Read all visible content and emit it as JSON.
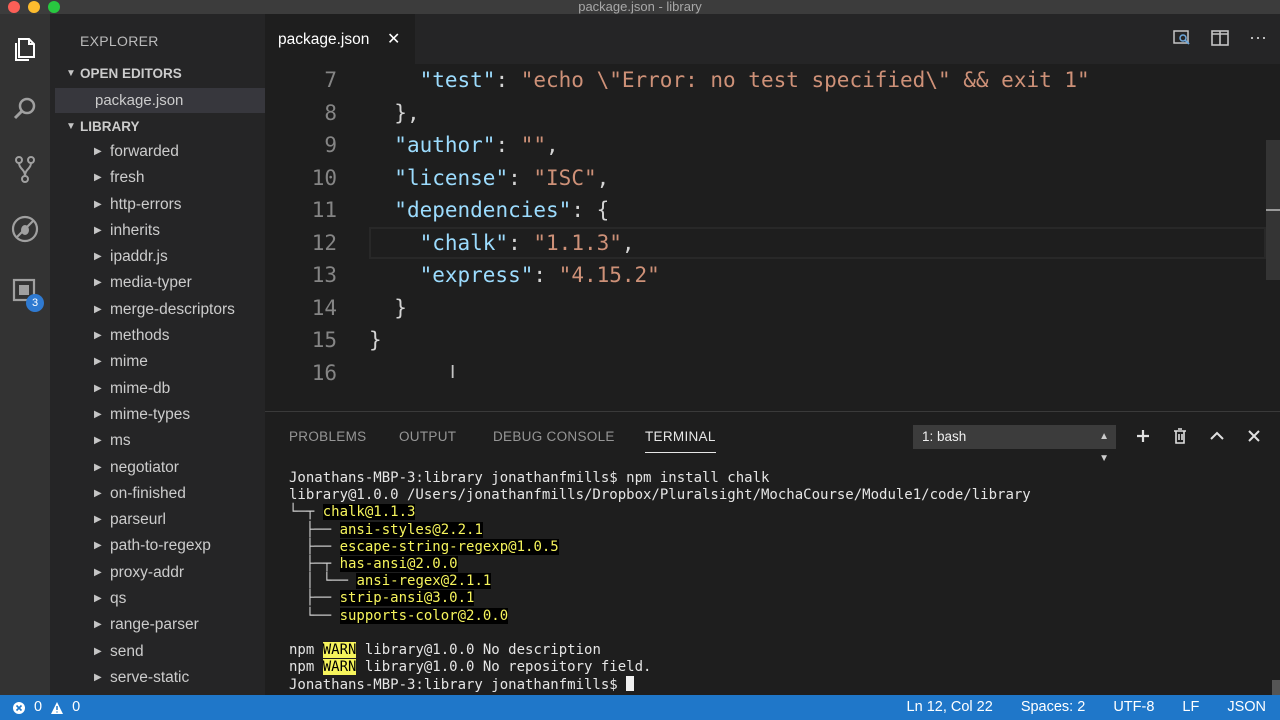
{
  "window": {
    "title": "package.json - library"
  },
  "activity_bar": {
    "items": [
      {
        "name": "explorer",
        "icon": "files-icon"
      },
      {
        "name": "search",
        "icon": "search-icon"
      },
      {
        "name": "source-control",
        "icon": "git-branch-icon"
      },
      {
        "name": "debug",
        "icon": "debug-icon"
      },
      {
        "name": "extensions",
        "icon": "extensions-icon",
        "badge": "3"
      }
    ]
  },
  "sidebar": {
    "title": "EXPLORER",
    "open_editors": {
      "label": "OPEN EDITORS",
      "files": [
        "package.json"
      ]
    },
    "folder": {
      "label": "LIBRARY"
    },
    "tree": [
      "forwarded",
      "fresh",
      "http-errors",
      "inherits",
      "ipaddr.js",
      "media-typer",
      "merge-descriptors",
      "methods",
      "mime",
      "mime-db",
      "mime-types",
      "ms",
      "negotiator",
      "on-finished",
      "parseurl",
      "path-to-regexp",
      "proxy-addr",
      "qs",
      "range-parser",
      "send",
      "serve-static"
    ]
  },
  "tabs": [
    {
      "label": "package.json",
      "close": "✕"
    }
  ],
  "editor": {
    "lines": [
      {
        "n": "7",
        "indent": "    ",
        "parts": [
          {
            "t": "\"test\"",
            "c": "k"
          },
          {
            "t": ": ",
            "c": "p"
          },
          {
            "t": "\"echo \\\"Error: no test specified\\\" && exit 1\"",
            "c": "s"
          }
        ]
      },
      {
        "n": "8",
        "indent": "  ",
        "parts": [
          {
            "t": "},",
            "c": "p"
          }
        ]
      },
      {
        "n": "9",
        "indent": "  ",
        "parts": [
          {
            "t": "\"author\"",
            "c": "k"
          },
          {
            "t": ": ",
            "c": "p"
          },
          {
            "t": "\"\"",
            "c": "s"
          },
          {
            "t": ",",
            "c": "p"
          }
        ]
      },
      {
        "n": "10",
        "indent": "  ",
        "parts": [
          {
            "t": "\"license\"",
            "c": "k"
          },
          {
            "t": ": ",
            "c": "p"
          },
          {
            "t": "\"ISC\"",
            "c": "s"
          },
          {
            "t": ",",
            "c": "p"
          }
        ]
      },
      {
        "n": "11",
        "indent": "  ",
        "parts": [
          {
            "t": "\"dependencies\"",
            "c": "k"
          },
          {
            "t": ": {",
            "c": "p"
          }
        ]
      },
      {
        "n": "12",
        "indent": "    ",
        "parts": [
          {
            "t": "\"chalk\"",
            "c": "k"
          },
          {
            "t": ": ",
            "c": "p"
          },
          {
            "t": "\"1.1.3\"",
            "c": "s"
          },
          {
            "t": ",",
            "c": "p"
          }
        ]
      },
      {
        "n": "13",
        "indent": "    ",
        "parts": [
          {
            "t": "\"express\"",
            "c": "k"
          },
          {
            "t": ": ",
            "c": "p"
          },
          {
            "t": "\"4.15.2\"",
            "c": "s"
          }
        ]
      },
      {
        "n": "14",
        "indent": "  ",
        "parts": [
          {
            "t": "}",
            "c": "p"
          }
        ]
      },
      {
        "n": "15",
        "indent": "",
        "parts": [
          {
            "t": "}",
            "c": "p"
          }
        ]
      },
      {
        "n": "16",
        "indent": "",
        "parts": []
      }
    ],
    "highlighted_line": "12"
  },
  "panel": {
    "tabs": [
      "PROBLEMS",
      "OUTPUT",
      "DEBUG CONSOLE",
      "TERMINAL"
    ],
    "active_tab": "TERMINAL",
    "terminal_select": "1: bash",
    "terminal_lines": [
      {
        "parts": [
          {
            "t": "Jonathans-MBP-3:library jonathanfmills$ npm install chalk"
          }
        ]
      },
      {
        "parts": [
          {
            "t": "library@1.0.0 /Users/jonathanfmills/Dropbox/Pluralsight/MochaCourse/Module1/code/library"
          }
        ]
      },
      {
        "parts": [
          {
            "t": "└─┬ ",
            "c": "tree-ln"
          },
          {
            "t": "chalk@1.1.3",
            "c": "hl-y"
          }
        ]
      },
      {
        "parts": [
          {
            "t": "  ├── ",
            "c": "tree-ln"
          },
          {
            "t": "ansi-styles@2.2.1",
            "c": "hl-y"
          }
        ]
      },
      {
        "parts": [
          {
            "t": "  ├── ",
            "c": "tree-ln"
          },
          {
            "t": "escape-string-regexp@1.0.5",
            "c": "hl-y"
          }
        ]
      },
      {
        "parts": [
          {
            "t": "  ├─┬ ",
            "c": "tree-ln"
          },
          {
            "t": "has-ansi@2.0.0",
            "c": "hl-y"
          }
        ]
      },
      {
        "parts": [
          {
            "t": "  │ └── ",
            "c": "tree-ln"
          },
          {
            "t": "ansi-regex@2.1.1",
            "c": "hl-y"
          }
        ]
      },
      {
        "parts": [
          {
            "t": "  ├── ",
            "c": "tree-ln"
          },
          {
            "t": "strip-ansi@3.0.1",
            "c": "hl-y"
          }
        ]
      },
      {
        "parts": [
          {
            "t": "  └── ",
            "c": "tree-ln"
          },
          {
            "t": "supports-color@2.0.0",
            "c": "hl-y"
          }
        ]
      },
      {
        "parts": [
          {
            "t": ""
          }
        ]
      },
      {
        "parts": [
          {
            "t": "npm "
          },
          {
            "t": "WARN",
            "c": "warn"
          },
          {
            "t": " library@1.0.0 No description"
          }
        ]
      },
      {
        "parts": [
          {
            "t": "npm "
          },
          {
            "t": "WARN",
            "c": "warn"
          },
          {
            "t": " library@1.0.0 No repository field."
          }
        ]
      },
      {
        "parts": [
          {
            "t": "Jonathans-MBP-3:library jonathanfmills$ "
          }
        ],
        "cursor": true
      }
    ]
  },
  "status_bar": {
    "errors": "0",
    "warnings": "0",
    "position": "Ln 12, Col 22",
    "spaces": "Spaces: 2",
    "encoding": "UTF-8",
    "eol": "LF",
    "language": "JSON"
  },
  "colors": {
    "status_bar": "#1f77c9",
    "json_key": "#9cdcfe",
    "json_string": "#ce9178",
    "warn_bg": "#f6f45c"
  }
}
